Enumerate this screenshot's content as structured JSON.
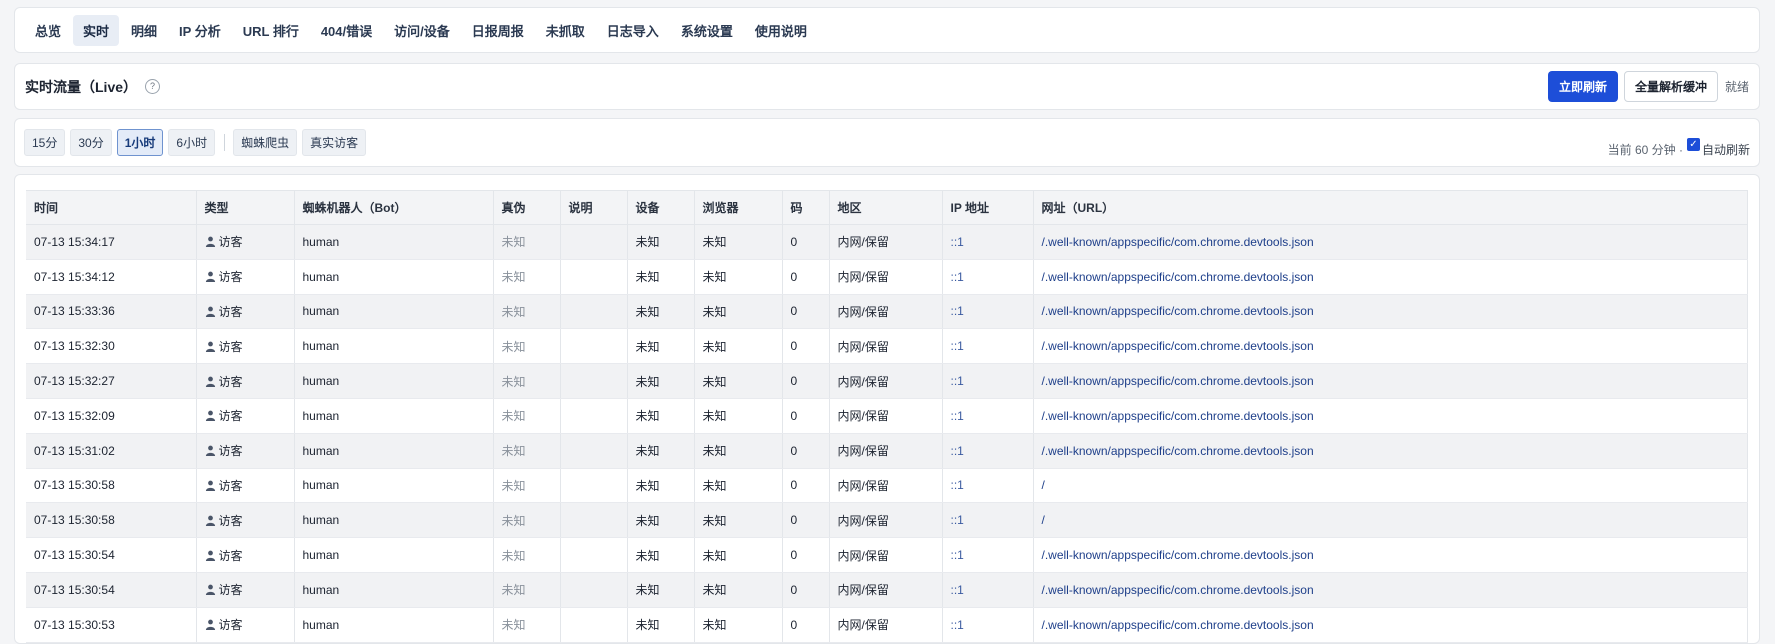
{
  "nav": {
    "items": [
      "总览",
      "实时",
      "明细",
      "IP 分析",
      "URL 排行",
      "404/错误",
      "访问/设备",
      "日报周报",
      "未抓取",
      "日志导入",
      "系统设置",
      "使用说明"
    ],
    "active": "实时"
  },
  "header": {
    "title": "实时流量（Live）",
    "help_icon": "?",
    "refresh_label": "立即刷新",
    "flush_label": "全量解析缓冲",
    "status": "就绪"
  },
  "filters": {
    "ranges": [
      "15分",
      "30分",
      "1小时",
      "6小时"
    ],
    "active_range": "1小时",
    "types": [
      "蜘蛛爬虫",
      "真实访客"
    ],
    "current_text": "当前 60 分钟 ·",
    "auto_refresh_checked": true,
    "auto_refresh_label": "自动刷新"
  },
  "table": {
    "columns": [
      "时间",
      "类型",
      "蜘蛛机器人（Bot）",
      "真伪",
      "说明",
      "设备",
      "浏览器",
      "码",
      "地区",
      "IP 地址",
      "网址（URL）"
    ],
    "rows": [
      {
        "time": "07-13 15:34:17",
        "type": "访客",
        "bot": "human",
        "auth": "未知",
        "note": "",
        "device": "未知",
        "browser": "未知",
        "code": "0",
        "region": "内网/保留",
        "ip": "::1",
        "url": "/.well-known/appspecific/com.chrome.devtools.json"
      },
      {
        "time": "07-13 15:34:12",
        "type": "访客",
        "bot": "human",
        "auth": "未知",
        "note": "",
        "device": "未知",
        "browser": "未知",
        "code": "0",
        "region": "内网/保留",
        "ip": "::1",
        "url": "/.well-known/appspecific/com.chrome.devtools.json"
      },
      {
        "time": "07-13 15:33:36",
        "type": "访客",
        "bot": "human",
        "auth": "未知",
        "note": "",
        "device": "未知",
        "browser": "未知",
        "code": "0",
        "region": "内网/保留",
        "ip": "::1",
        "url": "/.well-known/appspecific/com.chrome.devtools.json"
      },
      {
        "time": "07-13 15:32:30",
        "type": "访客",
        "bot": "human",
        "auth": "未知",
        "note": "",
        "device": "未知",
        "browser": "未知",
        "code": "0",
        "region": "内网/保留",
        "ip": "::1",
        "url": "/.well-known/appspecific/com.chrome.devtools.json"
      },
      {
        "time": "07-13 15:32:27",
        "type": "访客",
        "bot": "human",
        "auth": "未知",
        "note": "",
        "device": "未知",
        "browser": "未知",
        "code": "0",
        "region": "内网/保留",
        "ip": "::1",
        "url": "/.well-known/appspecific/com.chrome.devtools.json"
      },
      {
        "time": "07-13 15:32:09",
        "type": "访客",
        "bot": "human",
        "auth": "未知",
        "note": "",
        "device": "未知",
        "browser": "未知",
        "code": "0",
        "region": "内网/保留",
        "ip": "::1",
        "url": "/.well-known/appspecific/com.chrome.devtools.json"
      },
      {
        "time": "07-13 15:31:02",
        "type": "访客",
        "bot": "human",
        "auth": "未知",
        "note": "",
        "device": "未知",
        "browser": "未知",
        "code": "0",
        "region": "内网/保留",
        "ip": "::1",
        "url": "/.well-known/appspecific/com.chrome.devtools.json"
      },
      {
        "time": "07-13 15:30:58",
        "type": "访客",
        "bot": "human",
        "auth": "未知",
        "note": "",
        "device": "未知",
        "browser": "未知",
        "code": "0",
        "region": "内网/保留",
        "ip": "::1",
        "url": "/"
      },
      {
        "time": "07-13 15:30:58",
        "type": "访客",
        "bot": "human",
        "auth": "未知",
        "note": "",
        "device": "未知",
        "browser": "未知",
        "code": "0",
        "region": "内网/保留",
        "ip": "::1",
        "url": "/"
      },
      {
        "time": "07-13 15:30:54",
        "type": "访客",
        "bot": "human",
        "auth": "未知",
        "note": "",
        "device": "未知",
        "browser": "未知",
        "code": "0",
        "region": "内网/保留",
        "ip": "::1",
        "url": "/.well-known/appspecific/com.chrome.devtools.json"
      },
      {
        "time": "07-13 15:30:54",
        "type": "访客",
        "bot": "human",
        "auth": "未知",
        "note": "",
        "device": "未知",
        "browser": "未知",
        "code": "0",
        "region": "内网/保留",
        "ip": "::1",
        "url": "/.well-known/appspecific/com.chrome.devtools.json"
      },
      {
        "time": "07-13 15:30:53",
        "type": "访客",
        "bot": "human",
        "auth": "未知",
        "note": "",
        "device": "未知",
        "browser": "未知",
        "code": "0",
        "region": "内网/保留",
        "ip": "::1",
        "url": "/.well-known/appspecific/com.chrome.devtools.json"
      }
    ]
  },
  "colors": {
    "primary": "#1d4ed8",
    "link": "#1e3f8a",
    "person_icon": "#4a5568"
  },
  "icons": {
    "type_icon": "person-icon",
    "check": "checkmark-icon"
  }
}
